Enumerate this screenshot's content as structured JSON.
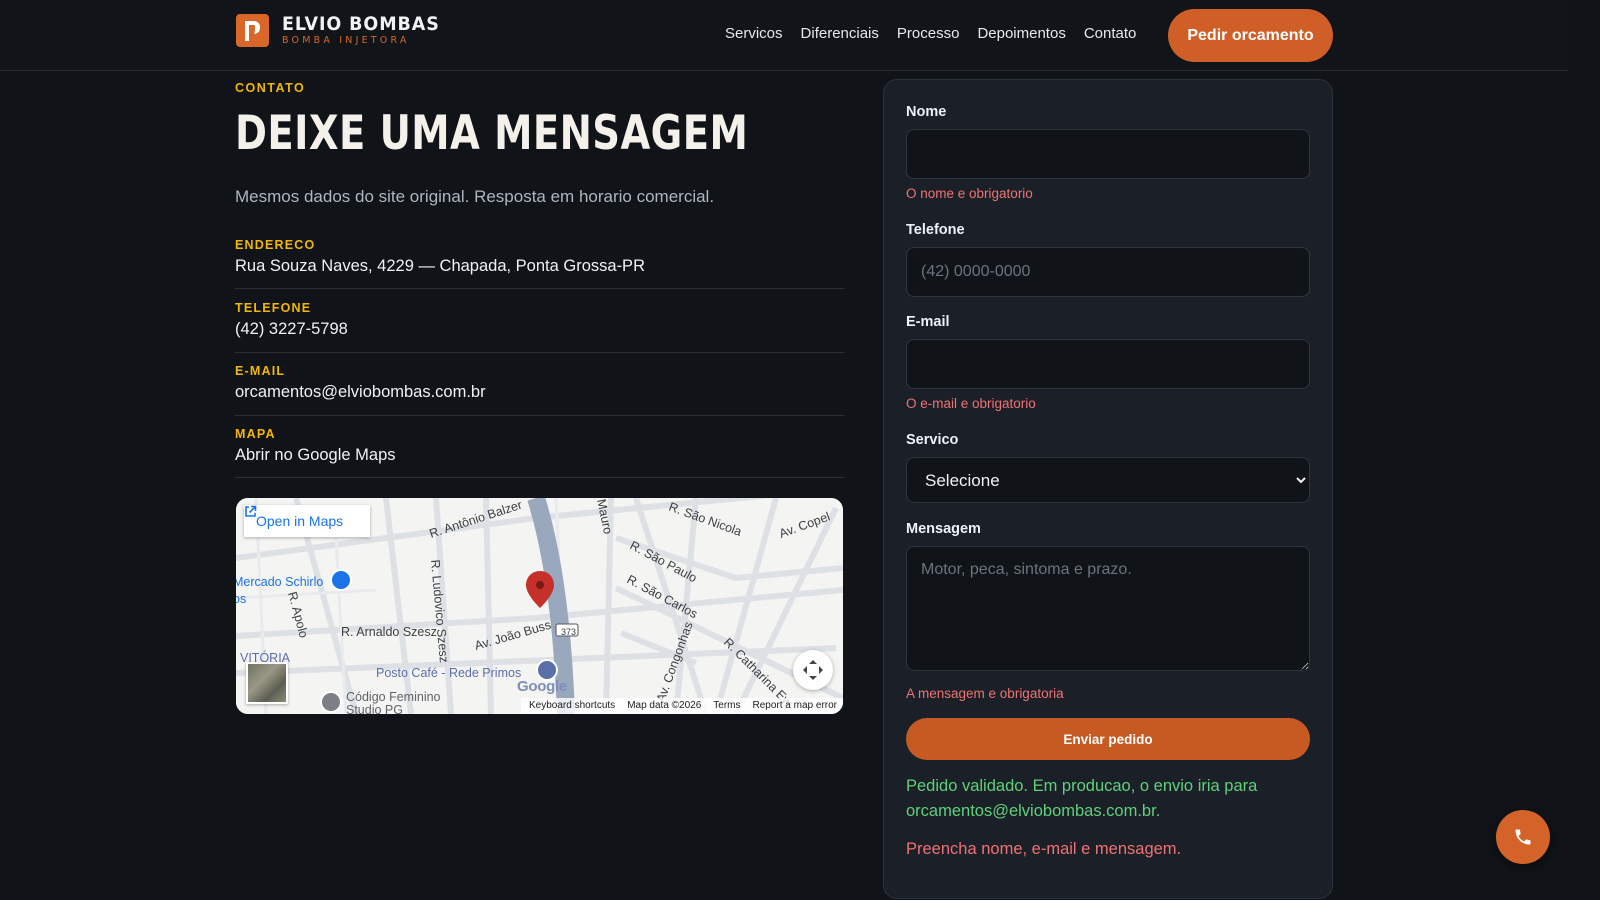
{
  "brand": {
    "name": "ELVIO BOMBAS",
    "tagline": "BOMBA INJETORA"
  },
  "nav": {
    "items": [
      "Servicos",
      "Diferenciais",
      "Processo",
      "Depoimentos",
      "Contato"
    ],
    "cta": "Pedir orcamento"
  },
  "contact": {
    "eyebrow": "CONTATO",
    "title": "DEIXE UMA MENSAGEM",
    "lead": "Mesmos dados do site original. Resposta em horario comercial.",
    "items": [
      {
        "label": "ENDERECO",
        "value": "Rua Souza Naves, 4229 — Chapada, Ponta Grossa-PR"
      },
      {
        "label": "TELEFONE",
        "value": "(42) 3227-5798"
      },
      {
        "label": "E-MAIL",
        "value": "orcamentos@elviobombas.com.br"
      },
      {
        "label": "MAPA",
        "value": "Abrir no Google Maps"
      }
    ]
  },
  "map": {
    "open_label": "Open in Maps",
    "streets": [
      "R. Antônio Balzer",
      "R. São Nicola",
      "Av. Copel",
      "R. São Paulo",
      "R. São Carlos",
      "R. Ludovico Szesz",
      "R. Apolo",
      "R. Arnaldo Szesz",
      "Av. João Buss",
      "Av. Congonhas",
      "R. Catharina Ew",
      "Mauro"
    ],
    "route_badge": "373",
    "places": [
      "Mercado Schirlo",
      "Posto Café - Rede Primos",
      "Código Feminino Studio PG",
      "VITÓRIA"
    ],
    "footer": [
      "Keyboard shortcuts",
      "Map data ©2026",
      "Terms",
      "Report a map error"
    ],
    "logo": "Google"
  },
  "form": {
    "name_label": "Nome",
    "name_error": "O nome e obrigatorio",
    "phone_label": "Telefone",
    "phone_placeholder": "(42) 0000-0000",
    "email_label": "E-mail",
    "email_error": "O e-mail e obrigatorio",
    "service_label": "Servico",
    "service_selected": "Selecione",
    "message_label": "Mensagem",
    "message_placeholder": "Motor, peca, sintoma e prazo.",
    "message_error": "A mensagem e obrigatoria",
    "submit": "Enviar pedido",
    "success": "Pedido validado. Em producao, o envio iria para orcamentos@elviobombas.com.br.",
    "failure": "Preencha nome, e-mail e mensagem."
  },
  "colors": {
    "accent": "#cf5f27",
    "eyebrow": "#f2b705",
    "success": "#5fd07a",
    "error": "#ef7272"
  },
  "icons": {
    "fab": "phone-icon",
    "open_maps": "external-link-icon",
    "map_pin": "map-pin-icon"
  }
}
